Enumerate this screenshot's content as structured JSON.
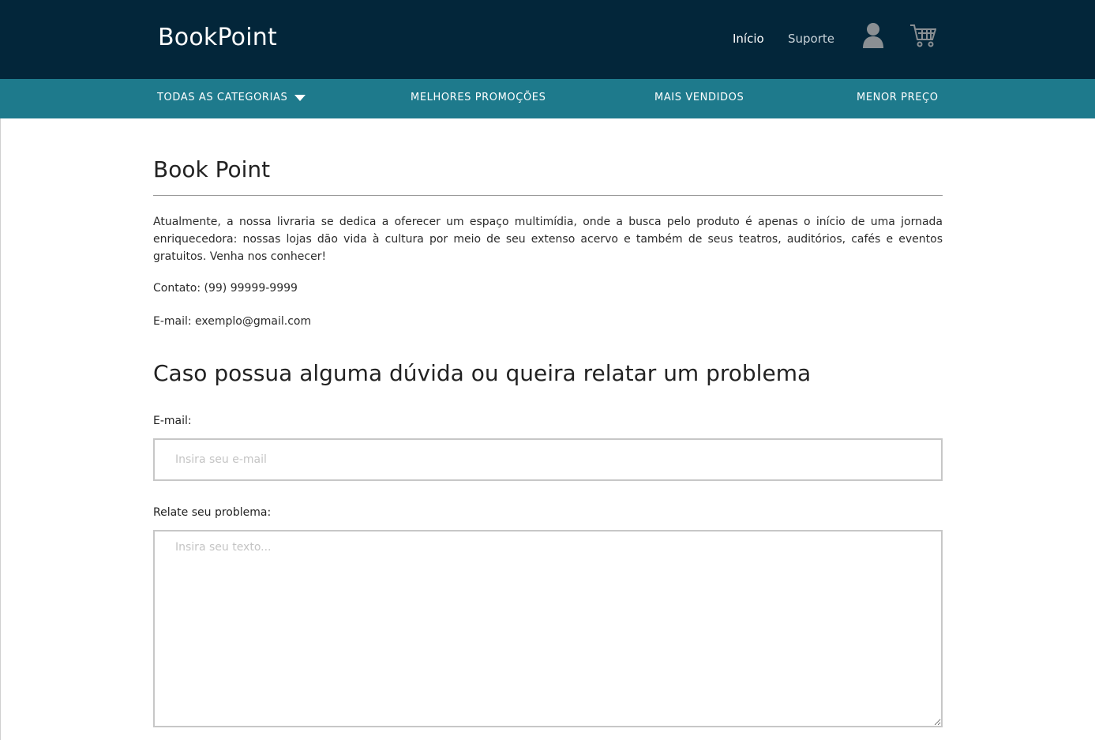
{
  "header": {
    "brand": "BookPoint",
    "nav": {
      "home_label": "Início",
      "support_label": "Suporte"
    },
    "icons": {
      "user": "user-icon",
      "cart": "cart-icon"
    },
    "colors": {
      "top_bar": "#03263a",
      "category_bar": "#1e7a8c"
    }
  },
  "categories": {
    "all_label": "TODAS AS CATEGORIAS",
    "promo_label": "MELHORES PROMOÇÕES",
    "best_sellers_label": "MAIS VENDIDOS",
    "lowest_price_label": "MENOR PREÇO"
  },
  "main": {
    "title": "Book Point",
    "about": "Atualmente, a nossa livraria se dedica a oferecer um espaço multimídia, onde a busca pelo produto é apenas o início de uma jornada enriquecedora: nossas lojas dão vida à cultura por meio de seu extenso acervo e também de seus teatros, auditórios, cafés e eventos gratuitos. Venha nos conhecer!",
    "contact": "Contato: (99) 99999-9999",
    "email_info": "E-mail: exemplo@gmail.com"
  },
  "form": {
    "title": "Caso possua alguma dúvida ou queira relatar um problema",
    "email_label": "E-mail:",
    "email_placeholder": "Insira seu e-mail",
    "problem_label": "Relate seu problema:",
    "problem_placeholder": "Insira seu texto..."
  }
}
